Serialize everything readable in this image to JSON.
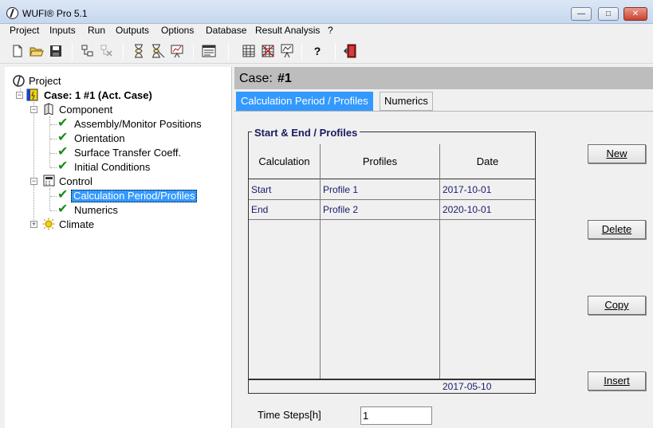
{
  "window": {
    "title": "WUFI® Pro 5.1",
    "min_glyph": "—",
    "max_glyph": "□",
    "close_glyph": "✕"
  },
  "menu": [
    "Project",
    "Inputs",
    "Run",
    "Outputs",
    "Options",
    "Database",
    "Result Analysis",
    "?"
  ],
  "toolbar_icons": [
    "new-file-icon",
    "open-folder-icon",
    "save-icon",
    "tree-add-icon",
    "tree-remove-icon",
    "hourglass-icon",
    "hourglass-multi-icon",
    "hourglass-chart-icon",
    "list-report-icon",
    "grid-table-icon",
    "grid-mesh-icon",
    "monitor-chart-icon",
    "help-icon",
    "exit-door-icon"
  ],
  "help_glyph": "?",
  "tree": {
    "project": "Project",
    "case": "Case: 1 #1 (Act. Case)",
    "component": "Component",
    "component_items": [
      "Assembly/Monitor Positions",
      "Orientation",
      "Surface Transfer Coeff.",
      "Initial Conditions"
    ],
    "control": "Control",
    "control_items": [
      "Calculation Period/Profiles",
      "Numerics"
    ],
    "climate": "Climate",
    "expanded_glyph": "−",
    "collapsed_glyph": "+"
  },
  "case_header": {
    "label": "Case:",
    "number": "#1"
  },
  "tabs": [
    "Calculation Period / Profiles",
    "Numerics"
  ],
  "group_title": "Start & End / Profiles",
  "grid": {
    "columns": [
      "Calculation",
      "Profiles",
      "Date"
    ],
    "rows": [
      {
        "calculation": "Start",
        "profile": "Profile 1",
        "date": "2017-10-01"
      },
      {
        "calculation": "End",
        "profile": "Profile 2",
        "date": "2020-10-01"
      }
    ],
    "footer_date": "2017-05-10"
  },
  "buttons": {
    "new": "New",
    "delete": "Delete",
    "copy": "Copy",
    "insert": "Insert"
  },
  "time_steps": {
    "label": "Time Steps[h]",
    "value": "1"
  },
  "colors": {
    "selection": "#3399ff",
    "check": "#1c8a1c",
    "header_gray": "#bdbdbd"
  }
}
